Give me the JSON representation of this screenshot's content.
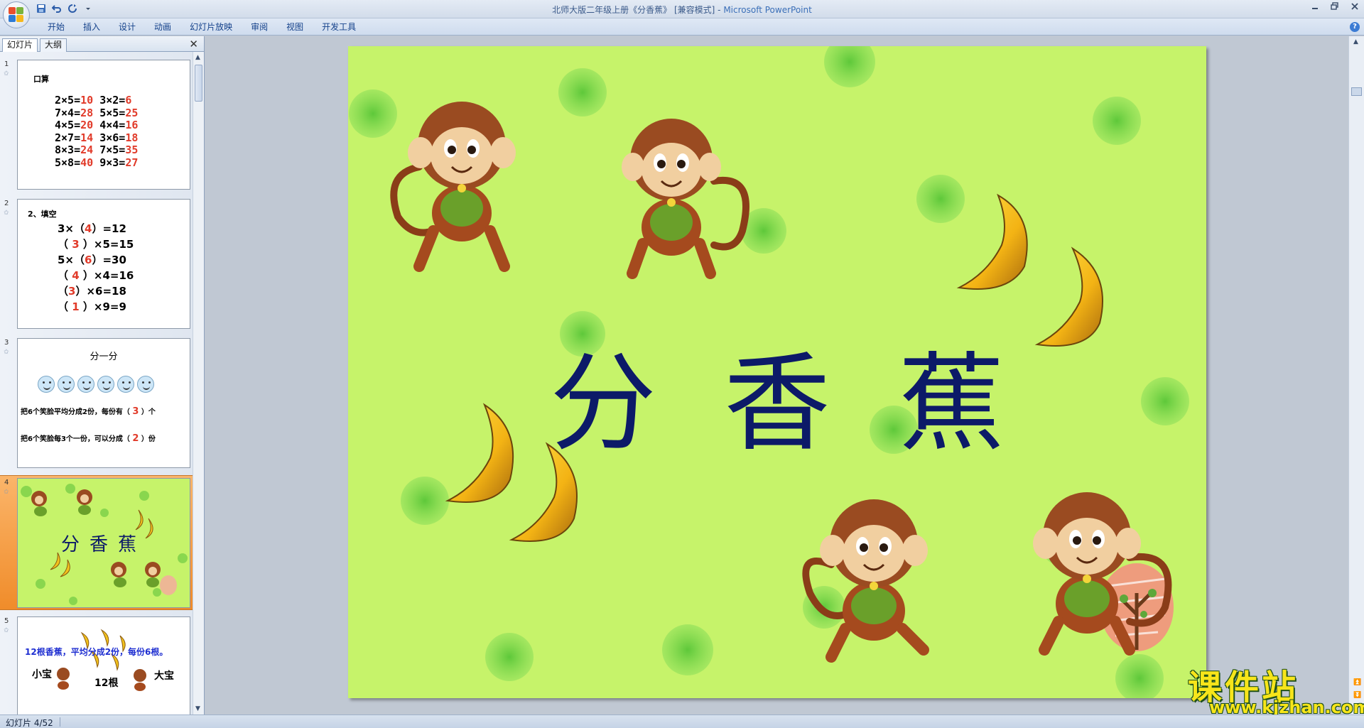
{
  "window": {
    "title": "北师大版二年级上册《分香蕉》 [兼容模式]",
    "app_separator": " - ",
    "app_name": "Microsoft PowerPoint"
  },
  "qat": {
    "icons": [
      "save-icon",
      "undo-icon",
      "redo-icon",
      "customize-icon"
    ]
  },
  "ribbon": {
    "tabs": [
      "开始",
      "插入",
      "设计",
      "动画",
      "幻灯片放映",
      "审阅",
      "视图",
      "开发工具"
    ]
  },
  "left_panel": {
    "tabs": [
      "幻灯片",
      "大纲"
    ],
    "thumbnails": [
      {
        "number": "1",
        "heading": "口算",
        "rows": [
          [
            "2×5=",
            "10",
            "3×2=",
            "6"
          ],
          [
            "7×4=",
            "28",
            "5×5=",
            "25"
          ],
          [
            "4×5=",
            "20",
            "4×4=",
            "16"
          ],
          [
            "2×7=",
            "14",
            "3×6=",
            "18"
          ],
          [
            "8×3=",
            "24",
            "7×5=",
            "35"
          ],
          [
            "5×8=",
            "40",
            "9×3=",
            "27"
          ]
        ]
      },
      {
        "number": "2",
        "heading": "2、填空",
        "lines": [
          [
            "3×（",
            "4",
            "）=12"
          ],
          [
            "（ ",
            "3",
            " ）×5=15"
          ],
          [
            "5×（",
            "6",
            "）=30"
          ],
          [
            "（ ",
            "4",
            " ）×4=16"
          ],
          [
            "（",
            "3",
            "）×6=18"
          ],
          [
            "（ ",
            "1",
            " ）×9=9"
          ]
        ]
      },
      {
        "number": "3",
        "heading": "分一分",
        "sentence1": [
          "把6个笑脸平均分成2份，每份有（ ",
          "3",
          " ）个"
        ],
        "sentence2": [
          "把6个笑脸每3个一份，可以分成（ ",
          "2",
          " ）份"
        ]
      },
      {
        "number": "4",
        "title": "分香蕉"
      },
      {
        "number": "5",
        "text": "12根香蕉，平均分成2份，每份6根。",
        "labels": [
          "小宝",
          "12根",
          "大宝"
        ]
      }
    ]
  },
  "slide": {
    "title": "分香蕉",
    "background": "#c6f36a",
    "title_color": "#0c1a68"
  },
  "status": {
    "slide_indicator": "幻灯片 4/52"
  },
  "watermark": {
    "main": "课件站",
    "url": "www.kjzhan.com"
  }
}
